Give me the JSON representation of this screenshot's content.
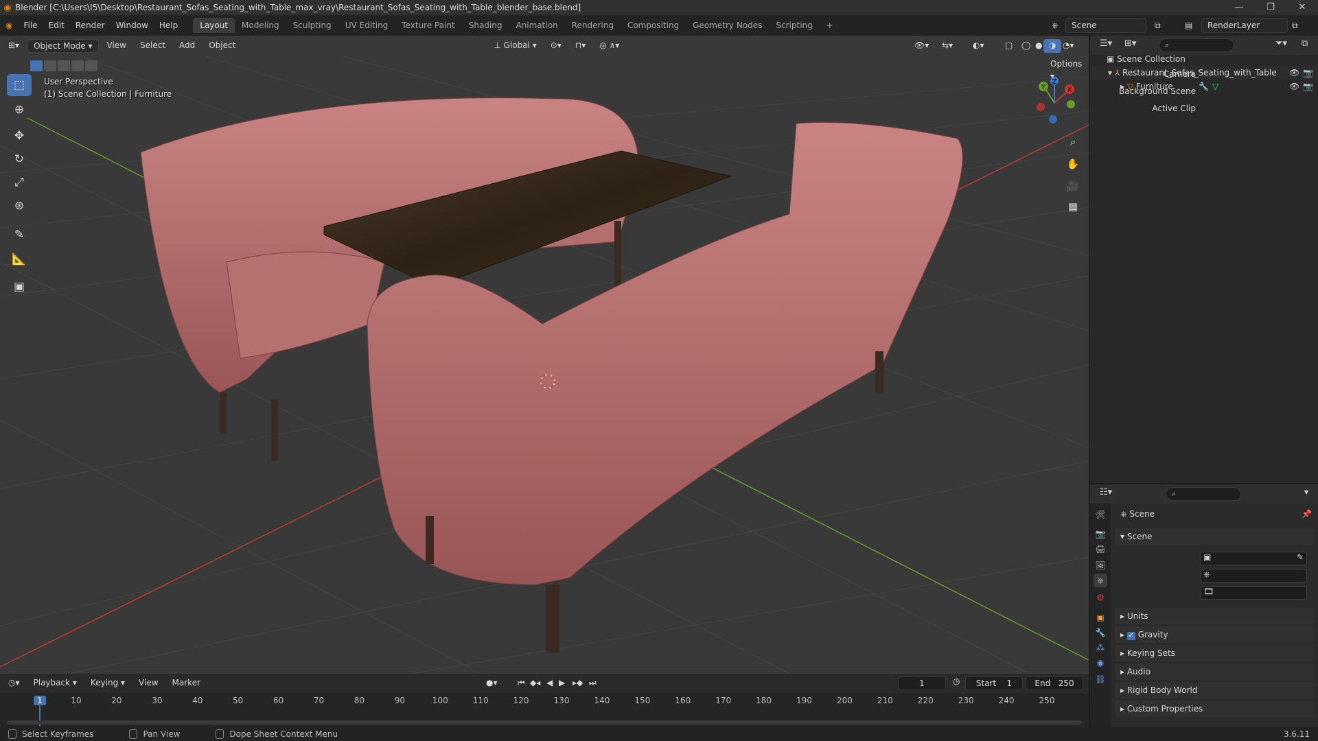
{
  "window": {
    "title": "Blender [C:\\Users\\I5\\Desktop\\Restaurant_Sofas_Seating_with_Table_max_vray\\Restaurant_Sofas_Seating_with_Table_blender_base.blend]",
    "version": "3.6.11"
  },
  "menu": [
    "File",
    "Edit",
    "Render",
    "Window",
    "Help"
  ],
  "workspaces": [
    "Layout",
    "Modeling",
    "Sculpting",
    "UV Editing",
    "Texture Paint",
    "Shading",
    "Animation",
    "Rendering",
    "Compositing",
    "Geometry Nodes",
    "Scripting"
  ],
  "active_workspace": "Layout",
  "scene_name": "Scene",
  "view_layer": "RenderLayer",
  "viewport": {
    "mode": "Object Mode",
    "menus": [
      "View",
      "Select",
      "Add",
      "Object"
    ],
    "transform_orientation": "Global",
    "options_label": "Options",
    "info_line1": "User Perspective",
    "info_line2": "(1) Scene Collection | Furniture",
    "gizmo": {
      "x": "X",
      "y": "Y",
      "z": "Z"
    },
    "colors": {
      "background": "#393939",
      "grid": "#454545",
      "x_axis": "#b83a3a",
      "y_axis": "#6a9a2a",
      "sofa": "#b86a6a",
      "table": "#3a2a1c"
    }
  },
  "outliner": {
    "root": "Scene Collection",
    "items": [
      {
        "label": "Restaurant_Sofas_Seating_with_Table"
      },
      {
        "label": "Furniture"
      }
    ]
  },
  "properties": {
    "header": "Scene",
    "panel": "Scene",
    "fields": [
      {
        "label": "Camera"
      },
      {
        "label": "Background Scene"
      },
      {
        "label": "Active Clip"
      }
    ],
    "sections": [
      "Units",
      "Gravity",
      "Keying Sets",
      "Audio",
      "Rigid Body World",
      "Custom Properties"
    ],
    "gravity_checked": true
  },
  "timeline": {
    "menus": [
      "Playback",
      "Keying",
      "View",
      "Marker"
    ],
    "current_frame": "1",
    "start_label": "Start",
    "start": "1",
    "end_label": "End",
    "end": "250",
    "ticks": [
      "1",
      "10",
      "20",
      "30",
      "40",
      "50",
      "60",
      "70",
      "80",
      "90",
      "100",
      "110",
      "120",
      "130",
      "140",
      "150",
      "160",
      "170",
      "180",
      "190",
      "200",
      "210",
      "220",
      "230",
      "240",
      "250"
    ]
  },
  "statusbar": [
    "Select Keyframes",
    "Pan View",
    "Dope Sheet Context Menu"
  ]
}
